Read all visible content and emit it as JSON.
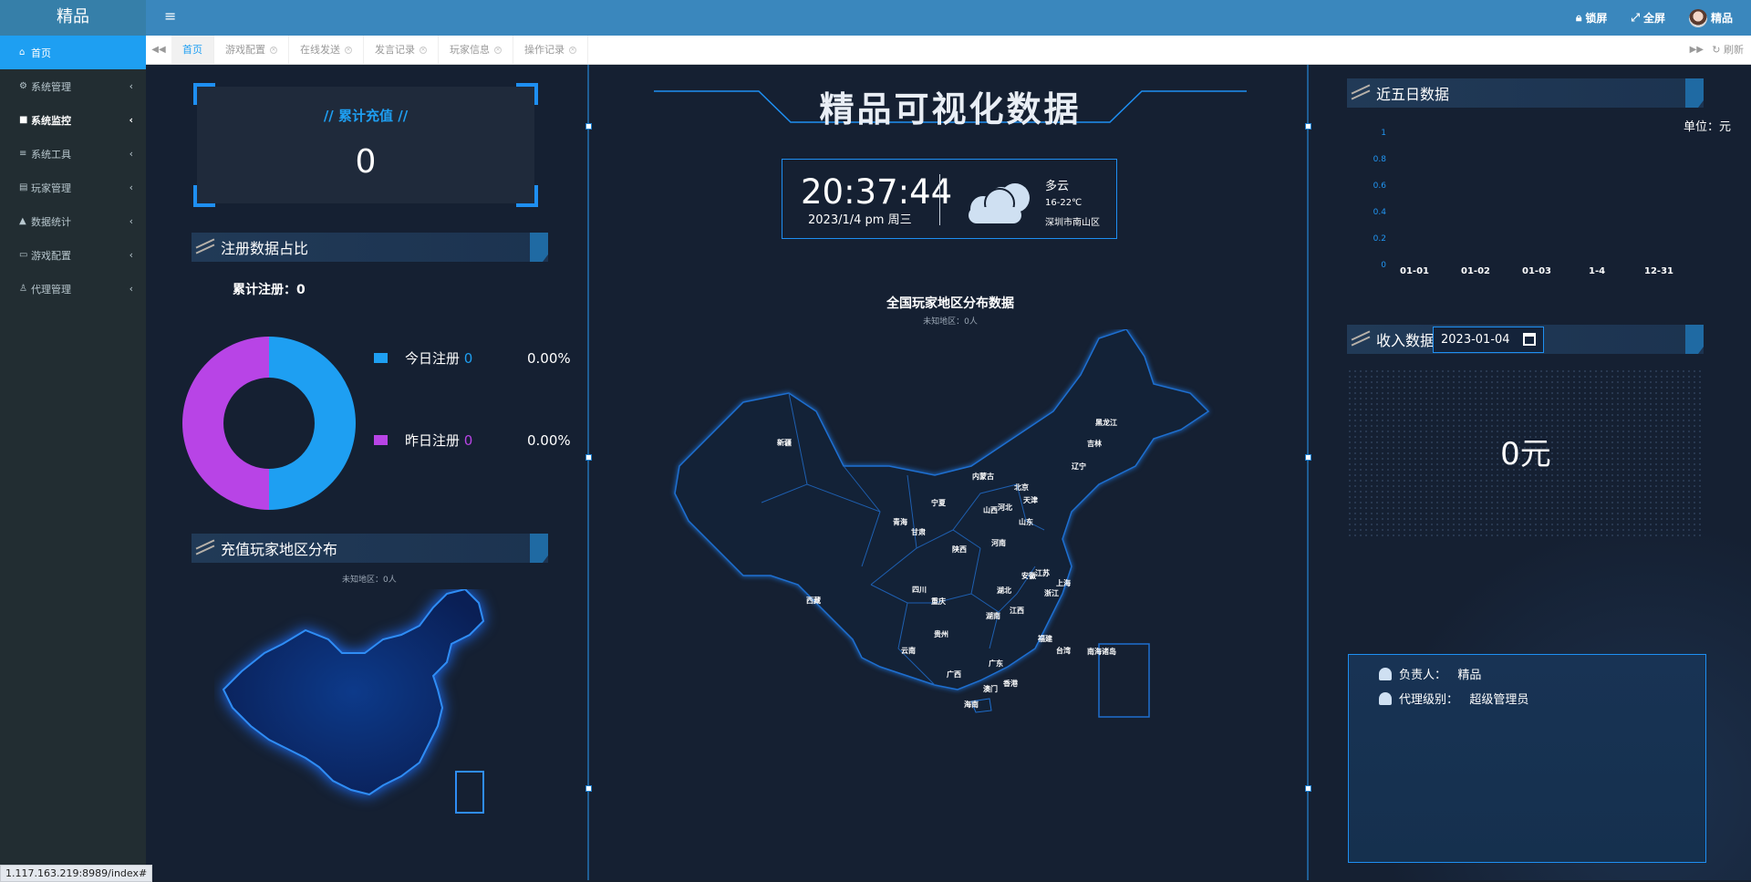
{
  "topbar": {
    "logo": "精品",
    "lock_label": "锁屏",
    "fullscreen_label": "全屏",
    "user_name": "精品"
  },
  "sidebar": {
    "items": [
      {
        "label": "首页",
        "icon": "home-icon",
        "active": true
      },
      {
        "label": "系统管理",
        "icon": "gear-icon"
      },
      {
        "label": "系统监控",
        "icon": "video-icon",
        "bold": true
      },
      {
        "label": "系统工具",
        "icon": "bars-icon"
      },
      {
        "label": "玩家管理",
        "icon": "book-icon"
      },
      {
        "label": "数据统计",
        "icon": "area-chart-icon"
      },
      {
        "label": "游戏配置",
        "icon": "desktop-icon"
      },
      {
        "label": "代理管理",
        "icon": "users-icon"
      }
    ]
  },
  "tabs": [
    {
      "label": "首页",
      "active": true,
      "closable": false
    },
    {
      "label": "游戏配置",
      "closable": true
    },
    {
      "label": "在线发送",
      "closable": true
    },
    {
      "label": "发言记录",
      "closable": true
    },
    {
      "label": "玩家信息",
      "closable": true
    },
    {
      "label": "操作记录",
      "closable": true
    }
  ],
  "tabbar": {
    "refresh_label": "刷新"
  },
  "left": {
    "recharge_title": "//   累计充值   //",
    "recharge_value": "0",
    "reg_section_title": "注册数据占比",
    "reg_total_label": "累计注册：",
    "reg_total_value": "0",
    "today_label": "今日注册",
    "today_value": "0",
    "today_pct": "0.00%",
    "yesterday_label": "昨日注册",
    "yesterday_value": "0",
    "yesterday_pct": "0.00%",
    "region_section_title": "充值玩家地区分布",
    "region_sub": "未知地区：0人"
  },
  "center": {
    "title": "精品可视化数据",
    "time": "20:37:44",
    "date": "2023/1/4   pm   周三",
    "weather": "多云",
    "temperature": "16-22℃",
    "location": "深圳市南山区",
    "map_title": "全国玩家地区分布数据",
    "map_sub": "未知地区：0人",
    "provinces": [
      "新疆",
      "西藏",
      "青海",
      "甘肃",
      "宁夏",
      "内蒙古",
      "黑龙江",
      "吉林",
      "辽宁",
      "北京",
      "天津",
      "河北",
      "山西",
      "山东",
      "陕西",
      "河南",
      "四川",
      "重庆",
      "湖北",
      "安徽",
      "江苏",
      "上海",
      "浙江",
      "江西",
      "湖南",
      "贵州",
      "云南",
      "广西",
      "广东",
      "福建",
      "台湾",
      "香港",
      "澳门",
      "海南",
      "南海诸岛"
    ]
  },
  "right": {
    "five_day_title": "近五日数据",
    "unit_label": "单位：元",
    "income_title": "收入数据",
    "income_date": "2023-01-04",
    "income_value": "0元",
    "owner_label": "负责人：",
    "owner_value": "精品",
    "level_label": "代理级别：",
    "level_value": "超级管理员"
  },
  "chart_data": {
    "type": "bar",
    "categories": [
      "01-01",
      "01-02",
      "01-03",
      "1-4",
      "12-31"
    ],
    "values": [
      0,
      0,
      0,
      0,
      0
    ],
    "yticks": [
      "0",
      "0.2",
      "0.4",
      "0.6",
      "0.8",
      "1"
    ],
    "ylim": [
      0,
      1
    ]
  },
  "registration_pie": {
    "type": "pie",
    "slices": [
      {
        "name": "今日注册",
        "value": 0,
        "color": "#1e9ff2"
      },
      {
        "name": "昨日注册",
        "value": 0,
        "color": "#b844e6"
      }
    ]
  },
  "status_url": "1.117.163.219:8989/index#",
  "colors": {
    "accent": "#1e9ff2",
    "purple": "#b844e6",
    "topbar": "#3a87bd",
    "sidebar": "#222d32"
  }
}
